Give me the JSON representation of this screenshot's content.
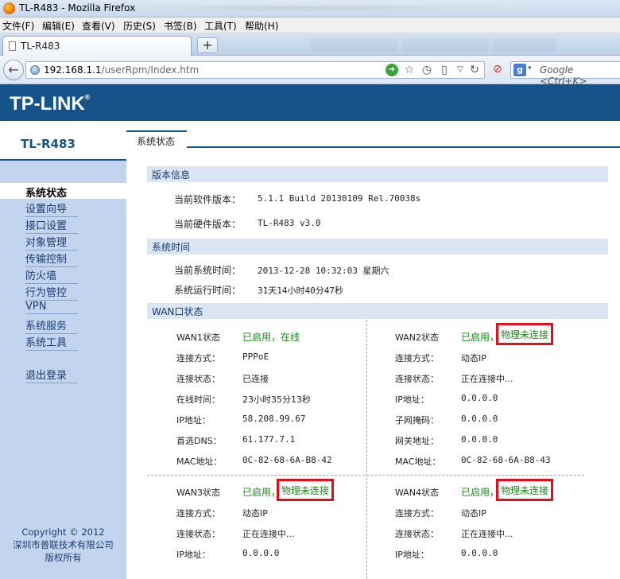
{
  "browser": {
    "window_title": "TL-R483 - Mozilla Firefox",
    "menu": [
      "文件(F)",
      "编辑(E)",
      "查看(V)",
      "历史(S)",
      "书签(B)",
      "工具(T)",
      "帮助(H)"
    ],
    "tab_title": "TL-R483",
    "new_tab": "+",
    "url_host": "192.168.1.1",
    "url_path": "/userRpm/Index.htm",
    "search_placeholder": "Google <Ctrl+K>"
  },
  "router": {
    "logo": "TP-LINK",
    "logo_mark": "®",
    "model": "TL-R483",
    "nav": [
      "系统状态",
      "设置向导",
      "接口设置",
      "对象管理",
      "传输控制",
      "防火墙",
      "行为管控",
      "VPN",
      "系统服务",
      "系统工具",
      "退出登录"
    ],
    "copyright": [
      "Copyright © 2012",
      "深圳市普联技术有限公司",
      "版权所有"
    ],
    "content_tab": "系统状态",
    "version": {
      "title": "版本信息",
      "software_label": "当前软件版本：",
      "software_value": "5.1.1 Build 20130109 Rel.70038s",
      "hardware_label": "当前硬件版本：",
      "hardware_value": "TL-R483 v3.0"
    },
    "time": {
      "title": "系统时间",
      "current_label": "当前系统时间：",
      "current_value": "2013-12-28 10:32:03 星期六",
      "uptime_label": "系统运行时间：",
      "uptime_value": "31天14小时40分47秒"
    },
    "wan": {
      "title": "WAN口状态",
      "labels": {
        "mode": "连接方式：",
        "conn": "连接状态：",
        "online": "在线时间：",
        "ip": "IP地址：",
        "dns": "首选DNS：",
        "mac": "MAC地址：",
        "mask": "子网掩码：",
        "gw": "网关地址："
      },
      "wan1": {
        "label": "WAN1状态",
        "status": "已启用，在线",
        "mode": "PPPoE",
        "conn": "已连接",
        "online": "23小时35分13秒",
        "ip": "58.208.99.67",
        "dns": "61.177.7.1",
        "mac": "0C-82-68-6A-B8-42"
      },
      "wan2": {
        "label": "WAN2状态",
        "status_enabled": "已启用，",
        "status_phys": "物理未连接",
        "mode": "动态IP",
        "conn": "正在连接中...",
        "ip": "0.0.0.0",
        "mask": "0.0.0.0",
        "gw": "0.0.0.0",
        "mac": "0C-82-68-6A-B8-43"
      },
      "wan3": {
        "label": "WAN3状态",
        "status_enabled": "已启用，",
        "status_phys": "物理未连接",
        "mode": "动态IP",
        "conn": "正在连接中...",
        "ip": "0.0.0.0"
      },
      "wan4": {
        "label": "WAN4状态",
        "status_enabled": "已启用，",
        "status_phys": "物理未连接",
        "mode": "动态IP",
        "conn": "正在连接中...",
        "ip": "0.0.0.0"
      }
    }
  },
  "colors": {
    "brand": "#16538a",
    "ok": "#1a8a1a",
    "alert": "#e0101a",
    "sidebar": "#c3d4ee"
  }
}
